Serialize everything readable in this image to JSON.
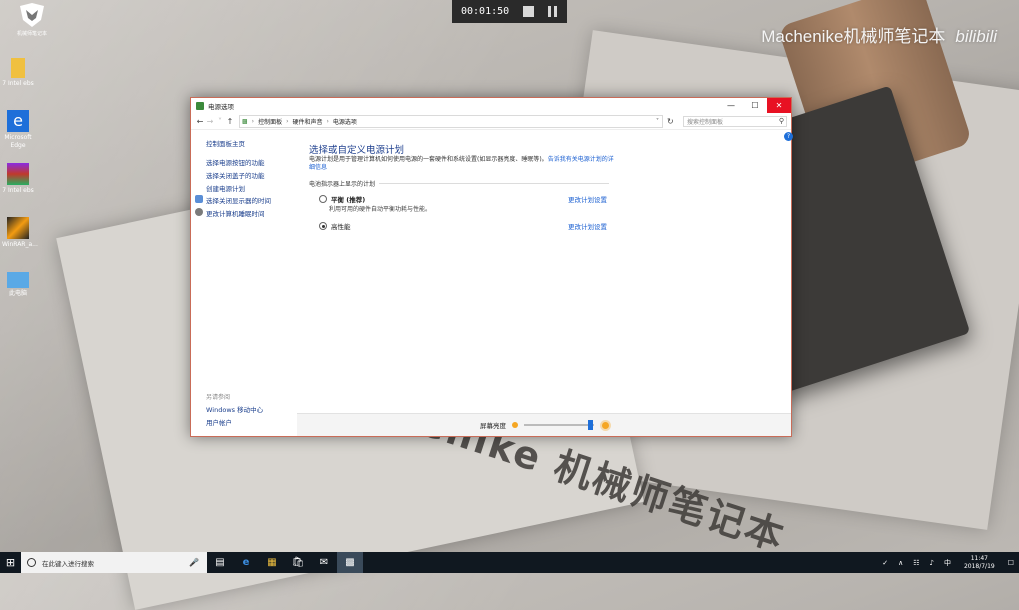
{
  "recorder": {
    "time": "00:01:50"
  },
  "watermark": {
    "brand": "Machenike机械师笔记本",
    "site": "bilibili"
  },
  "background": {
    "text": "Machenike 机械师笔记本"
  },
  "desktop": {
    "logo_caption": "机械师笔记本",
    "icons": [
      "7 Intel ebs",
      "Microsoft Edge",
      "7 Intel ebs",
      "WinRAR_a...",
      "此电脑"
    ]
  },
  "window": {
    "title": "电源选项",
    "address": [
      "控制面板",
      "硬件和声音",
      "电源选项"
    ],
    "search_placeholder": "搜索控制面板",
    "sidebar": {
      "home": "控制面板主页",
      "links": [
        "选择电源按钮的功能",
        "选择关闭盖子的功能",
        "创建电源计划",
        "选择关闭显示器的时间",
        "更改计算机睡眠时间"
      ],
      "see_also": "另请参阅",
      "see_also_links": [
        "Windows 移动中心",
        "用户帐户"
      ]
    },
    "content": {
      "heading": "选择或自定义电源计划",
      "desc": "电源计划是用于管理计算机如何使用电源的一套硬件和系统设置(如显示器亮度、睡眠等)。",
      "desc_link": "告诉我有关电源计划的详细信息",
      "group_label": "电池指示器上显示的计划",
      "plans": [
        {
          "name": "平衡 (推荐)",
          "desc": "利用可用的硬件自动平衡功耗与性能。",
          "link": "更改计划设置",
          "selected": false
        },
        {
          "name": "高性能",
          "desc": "",
          "link": "更改计划设置",
          "selected": true
        }
      ],
      "brightness_label": "屏幕亮度",
      "brightness_level": 0.95
    }
  },
  "taskbar": {
    "search_placeholder": "在此键入进行搜索",
    "time": "11:47",
    "date": "2018/7/19"
  },
  "colors": {
    "link": "#1a5fd1",
    "heading": "#1e3f8e",
    "close": "#e81123"
  }
}
